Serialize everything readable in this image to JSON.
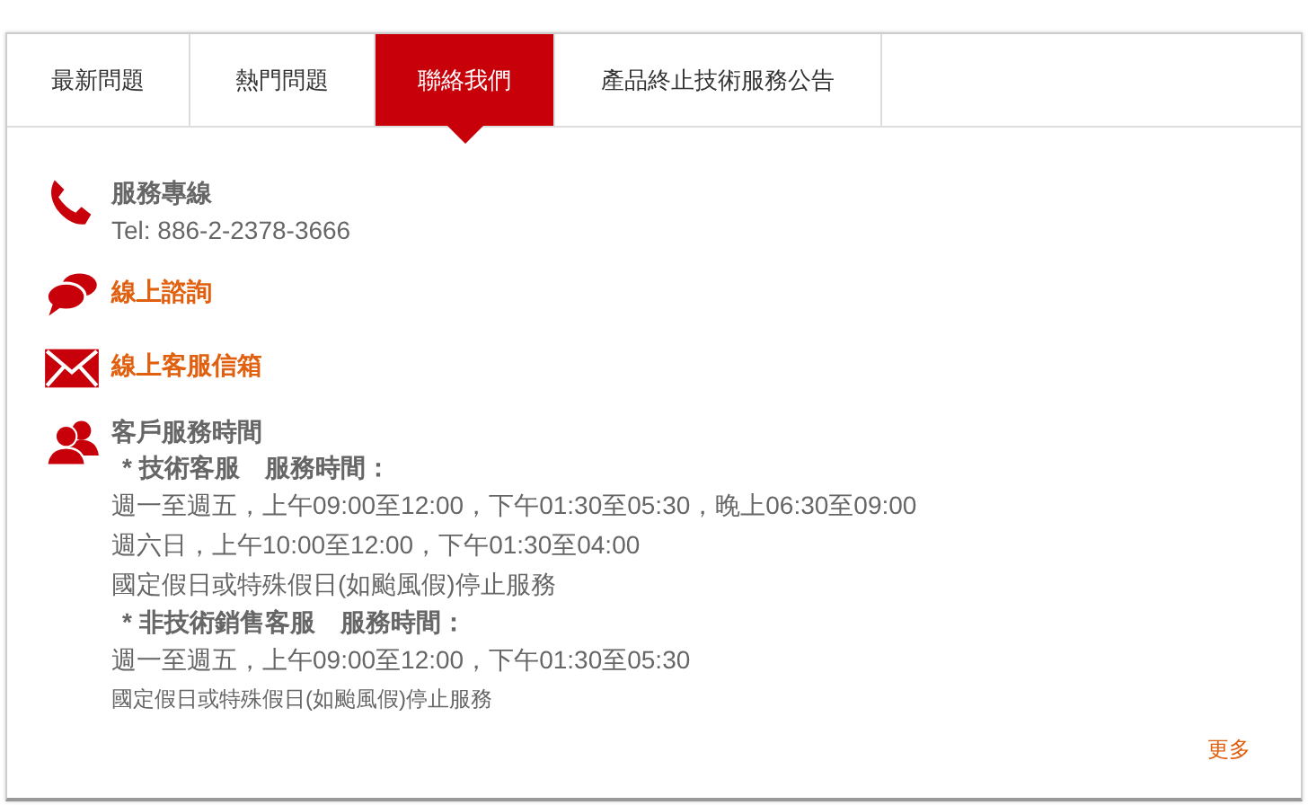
{
  "tabs": [
    {
      "label": "最新問題",
      "selected": false
    },
    {
      "label": "熱門問題",
      "selected": false
    },
    {
      "label": "聯絡我們",
      "selected": true
    },
    {
      "label": "產品終止技術服務公告",
      "selected": false
    }
  ],
  "contacts": [
    {
      "kind": "phone",
      "title": "服務專線",
      "detail": "Tel: 886-2-2378-3666"
    },
    {
      "kind": "chat",
      "link": "線上諮詢"
    },
    {
      "kind": "mail",
      "link": "線上客服信箱"
    },
    {
      "kind": "people",
      "title": "客戶服務時間",
      "lines": [
        {
          "kind": "heading",
          "text": "* 技術客服　服務時間："
        },
        {
          "kind": "line",
          "text": "週一至週五，上午09:00至12:00，下午01:30至05:30，晚上06:30至09:00"
        },
        {
          "kind": "line",
          "text": "週六日，上午10:00至12:00，下午01:30至04:00"
        },
        {
          "kind": "line",
          "text": "國定假日或特殊假日(如颱風假)停止服務"
        },
        {
          "kind": "heading",
          "text": "* 非技術銷售客服　服務時間："
        },
        {
          "kind": "line",
          "text": "週一至週五，上午09:00至12:00，下午01:30至05:30"
        },
        {
          "kind": "note",
          "text": "國定假日或特殊假日(如颱風假)停止服務"
        }
      ]
    }
  ],
  "more_link": "更多"
}
